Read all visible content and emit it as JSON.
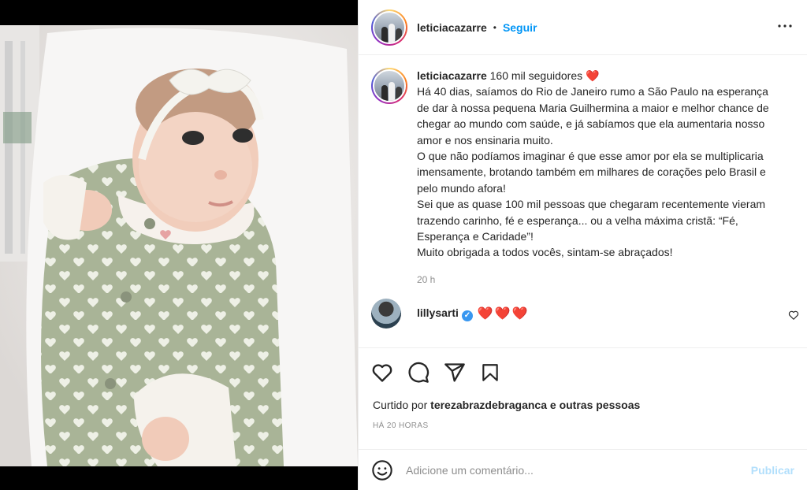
{
  "post": {
    "author": "leticiacazarre",
    "separator": "•",
    "follow_label": "Seguir",
    "more_label": "•••"
  },
  "caption": {
    "username": "leticiacazarre",
    "paragraphs": [
      "160 mil seguidores ❤️",
      "Há 40 dias, saíamos do Rio de Janeiro rumo a São Paulo na esperança de dar à nossa pequena Maria Guilhermina a maior e melhor chance de chegar ao mundo com saúde, e já sabíamos que ela aumentaria nosso amor e nos ensinaria muito.",
      "O que não podíamos imaginar é que esse amor por ela se multiplicaria imensamente, brotando também em milhares de corações pelo Brasil e pelo mundo afora!",
      "Sei que as quase 100 mil pessoas que chegaram recentemente vieram trazendo carinho, fé e esperança... ou a velha máxima cristã: “Fé, Esperança e Caridade”!",
      "Muito obrigada a todos vocês, sintam-se abraçados!"
    ],
    "time": "20 h"
  },
  "comment": {
    "username": "lillysarti",
    "verified_mark": "✓",
    "text": "❤️❤️❤️"
  },
  "likes": {
    "prefix": "Curtido por",
    "user": "terezabrazdebraganca",
    "suffix": "e outras pessoas"
  },
  "posted_ago": "HÁ 20 HORAS",
  "comment_box": {
    "placeholder": "Adicione um comentário...",
    "publish_label": "Publicar"
  },
  "icons": {
    "like": "heart-icon",
    "comment": "comment-icon",
    "share": "share-icon",
    "save": "bookmark-icon",
    "emoji": "emoji-icon",
    "more": "more-icon",
    "comment_like": "small-heart-icon"
  },
  "colors": {
    "link_blue": "#0095f6",
    "heart_red": "#ed4956",
    "muted": "#8e8e8e",
    "publish_disabled": "#b2dffc"
  }
}
